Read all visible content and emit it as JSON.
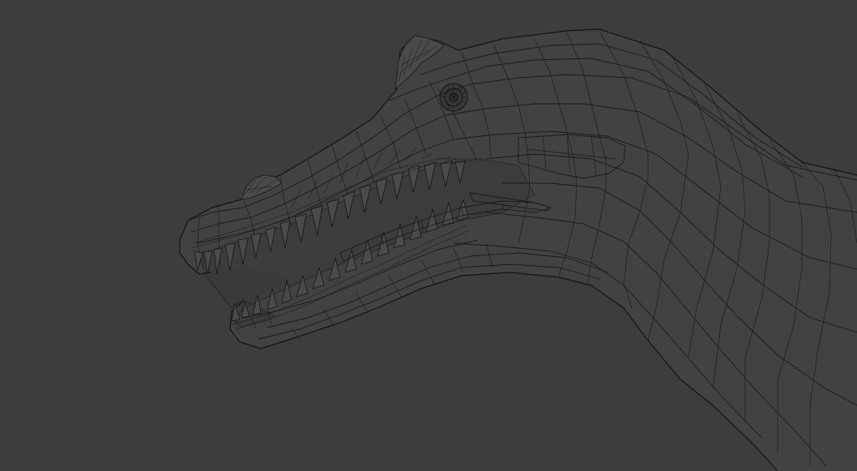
{
  "scene": {
    "subject": "dinosaur-head-wireframe",
    "view_mode": "wireframe",
    "colors": {
      "background": "#3d3d3d",
      "mesh_fill": "#424242",
      "wire": "#1a1a1a"
    },
    "icons": {
      "eye": "eye-mesh-icon"
    }
  }
}
